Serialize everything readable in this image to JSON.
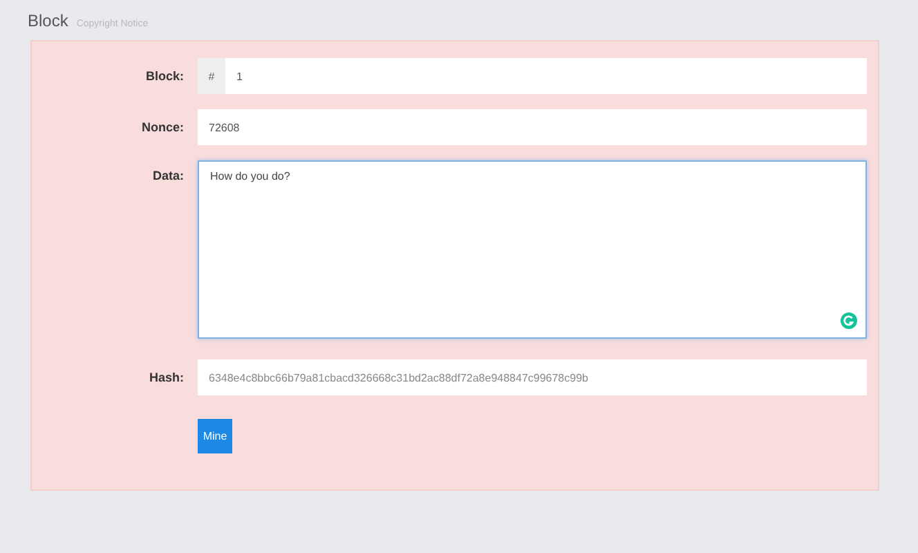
{
  "header": {
    "title": "Block",
    "subtitle": "Copyright Notice"
  },
  "form": {
    "block": {
      "label": "Block:",
      "prefix": "#",
      "value": "1"
    },
    "nonce": {
      "label": "Nonce:",
      "value": "72608"
    },
    "data": {
      "label": "Data:",
      "value": "How do you do?"
    },
    "hash": {
      "label": "Hash:",
      "value": "6348e4c8bbc66b79a81cbacd326668c31bd2ac88df72a8e948847c99678c99b"
    },
    "button": "Mine"
  }
}
